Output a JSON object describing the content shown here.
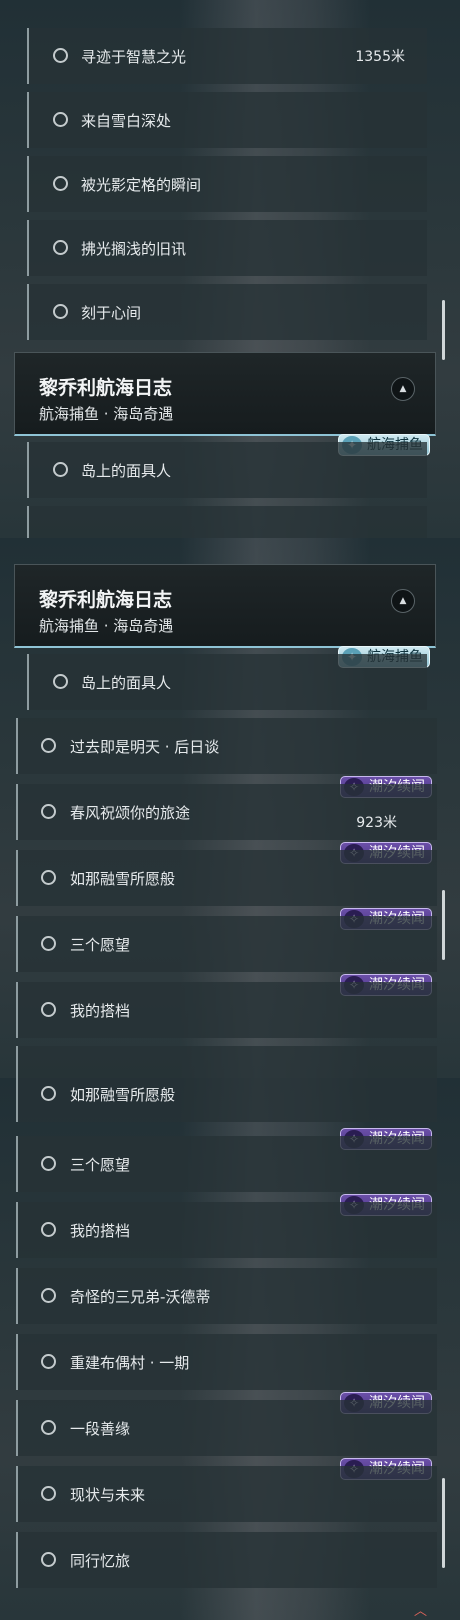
{
  "panel1": {
    "rows": [
      {
        "label": "寻迹于智慧之光",
        "distance": "1355米"
      },
      {
        "label": "来自雪白深处"
      },
      {
        "label": "被光影定格的瞬间"
      },
      {
        "label": "拂光搁浅的旧讯"
      },
      {
        "label": "刻于心间"
      }
    ],
    "header": {
      "title": "黎乔利航海日志",
      "subtitle": "航海捕鱼 · 海岛奇遇"
    },
    "badge": "航海捕鱼",
    "after_rows": [
      {
        "label": "岛上的面具人"
      }
    ]
  },
  "panel2": {
    "header": {
      "title": "黎乔利航海日志",
      "subtitle": "航海捕鱼 · 海岛奇遇"
    },
    "badge": "航海捕鱼",
    "sub_row": {
      "label": "岛上的面具人"
    },
    "rows": [
      {
        "label": "过去即是明天 · 后日谈"
      },
      {
        "label": "春风祝颂你的旅途",
        "badge": "潮汐续闻",
        "distance": "923米"
      },
      {
        "label": "如那融雪所愿般",
        "badge": "潮汐续闻"
      },
      {
        "label": "三个愿望",
        "badge": "潮汐续闻"
      },
      {
        "label": "我的搭档",
        "badge": "潮汐续闻"
      }
    ]
  },
  "panel3": {
    "rows": [
      {
        "label": "如那融雪所愿般"
      },
      {
        "label": "三个愿望",
        "badge": "潮汐续闻"
      },
      {
        "label": "我的搭档",
        "badge": "潮汐续闻"
      },
      {
        "label": "奇怪的三兄弟-沃德蒂"
      },
      {
        "label": "重建布偶村 · 一期"
      },
      {
        "label": "一段善缘",
        "badge": "潮汐续闻"
      },
      {
        "label": "现状与未来",
        "badge": "潮汐续闻"
      },
      {
        "label": "同行忆旅"
      }
    ]
  },
  "icons": {
    "quest_status": "circle-outline-icon",
    "collapse": "triangle-up-icon",
    "fishing": "fish-icon",
    "tide": "shell-icon"
  },
  "colors": {
    "tide_badge": "#5a3f98",
    "fish_badge": "#a9d5e3",
    "header_accent": "#8fc4d6"
  }
}
